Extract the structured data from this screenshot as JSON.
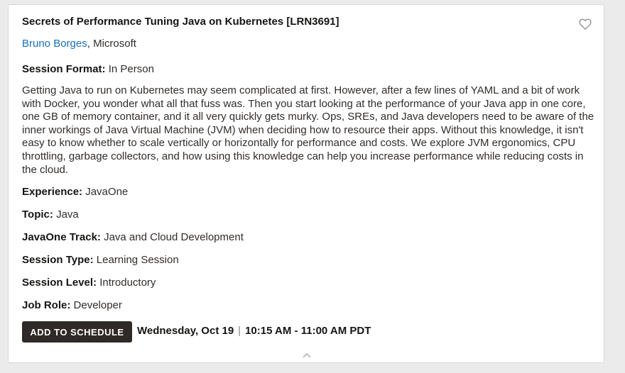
{
  "session": {
    "title": "Secrets of Performance Tuning Java on Kubernetes [LRN3691]",
    "speaker_name": "Bruno Borges",
    "speaker_org": ", Microsoft",
    "format_label": "Session Format:",
    "format_value": "In Person",
    "description": "Getting Java to run on Kubernetes may seem complicated at first. However, after a few lines of YAML and a bit of work with Docker, you wonder what all that fuss was. Then you start looking at the performance of your Java app in one core, one GB of memory container, and it all very quickly gets murky. Ops, SREs, and Java developers need to be aware of the inner workings of Java Virtual Machine (JVM) when deciding how to resource their apps. Without this knowledge, it isn't easy to know whether to scale vertically or horizontally for performance and costs. We explore JVM ergonomics, CPU throttling, garbage collectors, and how using this knowledge can help you increase performance while reducing costs in the cloud.",
    "fields": [
      {
        "label": "Experience:",
        "value": "JavaOne"
      },
      {
        "label": "Topic:",
        "value": "Java"
      },
      {
        "label": "JavaOne Track:",
        "value": "Java and Cloud Development"
      },
      {
        "label": "Session Type:",
        "value": "Learning Session"
      },
      {
        "label": "Session Level:",
        "value": "Introductory"
      },
      {
        "label": "Job Role:",
        "value": "Developer"
      }
    ],
    "schedule_button": "ADD TO SCHEDULE",
    "date": "Wednesday, Oct 19",
    "separator": "|",
    "time": "10:15 AM - 11:00 AM PDT"
  },
  "icons": {
    "favorite": "heart-outline-icon",
    "collapse": "chevron-up-icon"
  },
  "colors": {
    "link": "#1a6fb7",
    "button_bg": "#2f2a27",
    "text": "#312d2a"
  }
}
